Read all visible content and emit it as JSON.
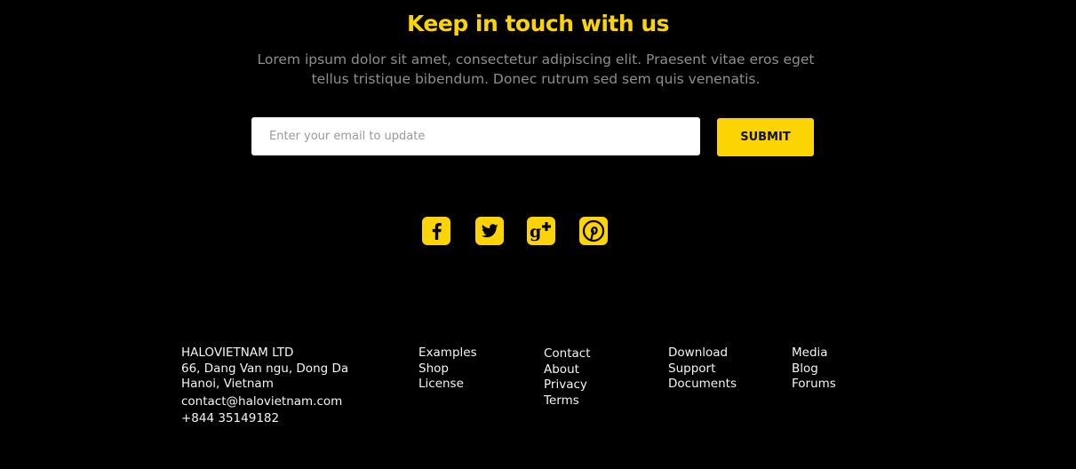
{
  "newsletter": {
    "title": "Keep in touch with us",
    "description": "Lorem ipsum dolor sit amet, consectetur adipiscing elit. Praesent vitae eros eget tellus tristique bibendum. Donec rutrum sed sem quis venenatis.",
    "email_placeholder": "Enter your email to update",
    "email_value": "",
    "submit_label": "SUBMIT"
  },
  "social": [
    {
      "icon": "facebook-icon"
    },
    {
      "icon": "twitter-icon"
    },
    {
      "icon": "google-plus-icon"
    },
    {
      "icon": "pinterest-icon"
    }
  ],
  "footer": {
    "company": {
      "name": "HALOVIETNAM LTD",
      "address_line1": "66, Dang Van ngu, Dong Da",
      "address_line2": "Hanoi, Vietnam",
      "email": "contact@halovietnam.com",
      "phone": "+844 35149182"
    },
    "columns": [
      {
        "links": [
          "Examples",
          "Shop",
          "License"
        ]
      },
      {
        "links": [
          "Contact",
          "About",
          "Privacy",
          "Terms"
        ]
      },
      {
        "links": [
          "Download",
          "Support",
          "Documents"
        ]
      },
      {
        "links": [
          "Media",
          "Blog",
          "Forums"
        ]
      }
    ]
  },
  "colors": {
    "accent": "#fcd404",
    "background": "#000000",
    "muted_text": "#8e8e8e",
    "footer_text": "#f4f4f4"
  }
}
